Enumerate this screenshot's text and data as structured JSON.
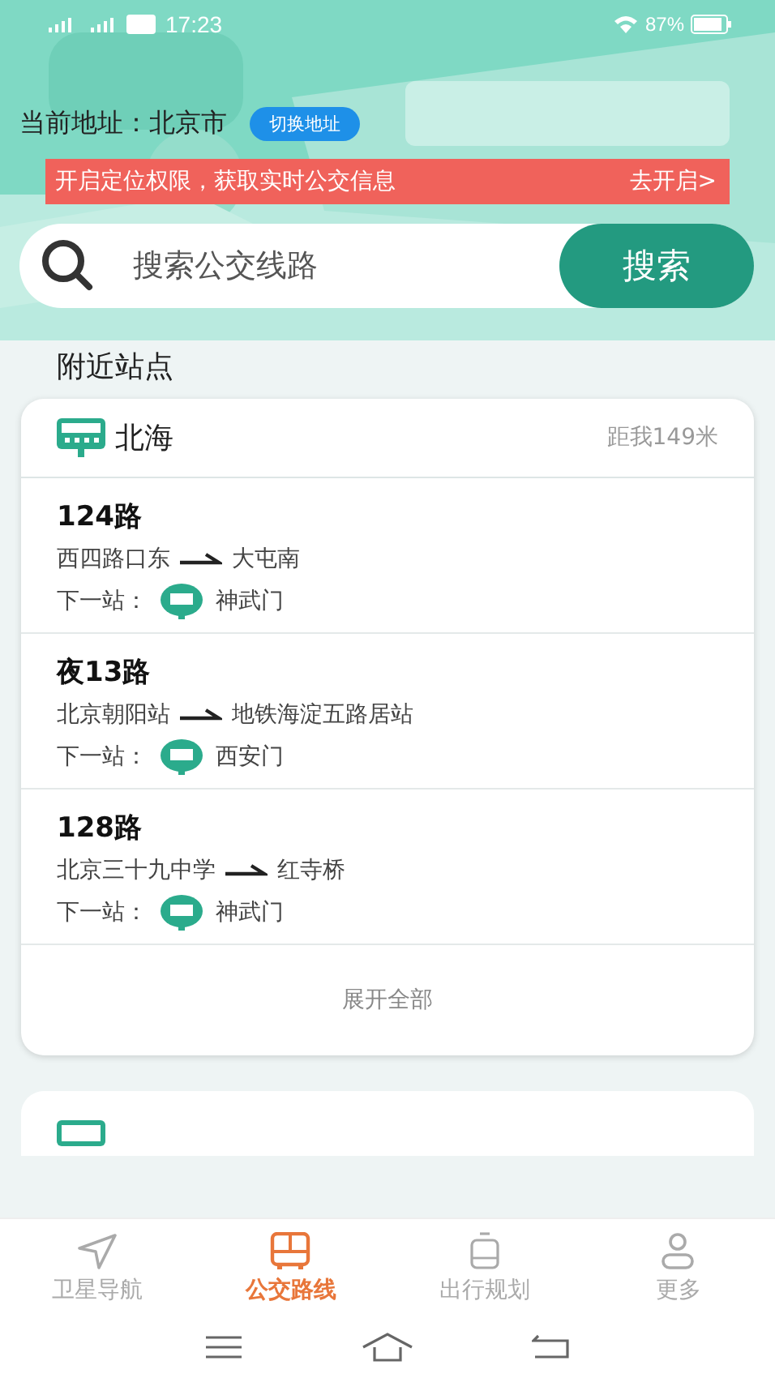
{
  "status_bar": {
    "time": "17:23",
    "battery": "87%"
  },
  "location": {
    "label": "当前地址：",
    "city": "北京市",
    "switch_button": "切换地址"
  },
  "permission_banner": {
    "message": "开启定位权限，获取实时公交信息",
    "action": "去开启>"
  },
  "search": {
    "placeholder": "搜索公交线路",
    "button": "搜索"
  },
  "section_title": "附近站点",
  "stations": [
    {
      "name": "北海",
      "distance": "距我149米",
      "routes": [
        {
          "route": "124路",
          "from": "西四路口东",
          "to": "大屯南",
          "next_label": "下一站：",
          "next_stop": "神武门"
        },
        {
          "route": "夜13路",
          "from": "北京朝阳站",
          "to": "地铁海淀五路居站",
          "next_label": "下一站：",
          "next_stop": "西安门"
        },
        {
          "route": "128路",
          "from": "北京三十九中学",
          "to": "红寺桥",
          "next_label": "下一站：",
          "next_stop": "神武门"
        }
      ],
      "expand": "展开全部"
    }
  ],
  "tabs": [
    {
      "label": "卫星导航",
      "kind": "navigate",
      "selected": false
    },
    {
      "label": "公交路线",
      "kind": "bus",
      "selected": true
    },
    {
      "label": "出行规划",
      "kind": "plan",
      "selected": false
    },
    {
      "label": "更多",
      "kind": "profile",
      "selected": false
    }
  ]
}
